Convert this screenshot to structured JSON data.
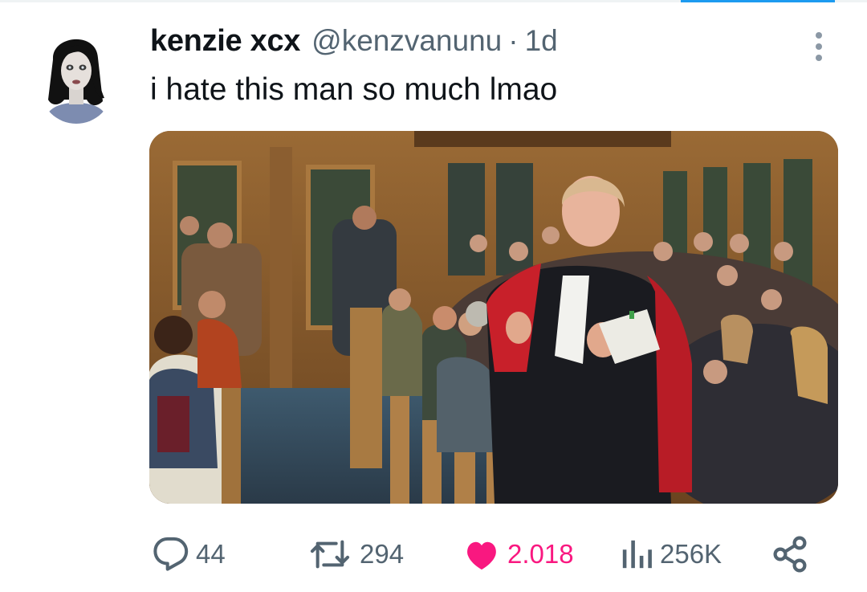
{
  "tweet": {
    "display_name": "kenzie xcx",
    "handle": "@kenzvanunu",
    "separator": "·",
    "time": "1d",
    "text": "i hate this man so much lmao"
  },
  "media": {
    "icon": "courtroom-photo",
    "accent_colors": {
      "robe_red": "#c8202a",
      "wood": "#8a5a2b",
      "panel_green": "#3b4a38"
    }
  },
  "actions": {
    "reply": {
      "icon": "reply-icon",
      "count": "44"
    },
    "retweet": {
      "icon": "retweet-icon",
      "count": "294"
    },
    "like": {
      "icon": "heart-icon",
      "count": "2.018",
      "active": true,
      "color": "#f91880"
    },
    "views": {
      "icon": "views-icon",
      "count": "256K"
    },
    "share": {
      "icon": "share-icon"
    }
  },
  "colors": {
    "text": "#0f1419",
    "secondary": "#536471",
    "accent": "#1d9bf0"
  }
}
